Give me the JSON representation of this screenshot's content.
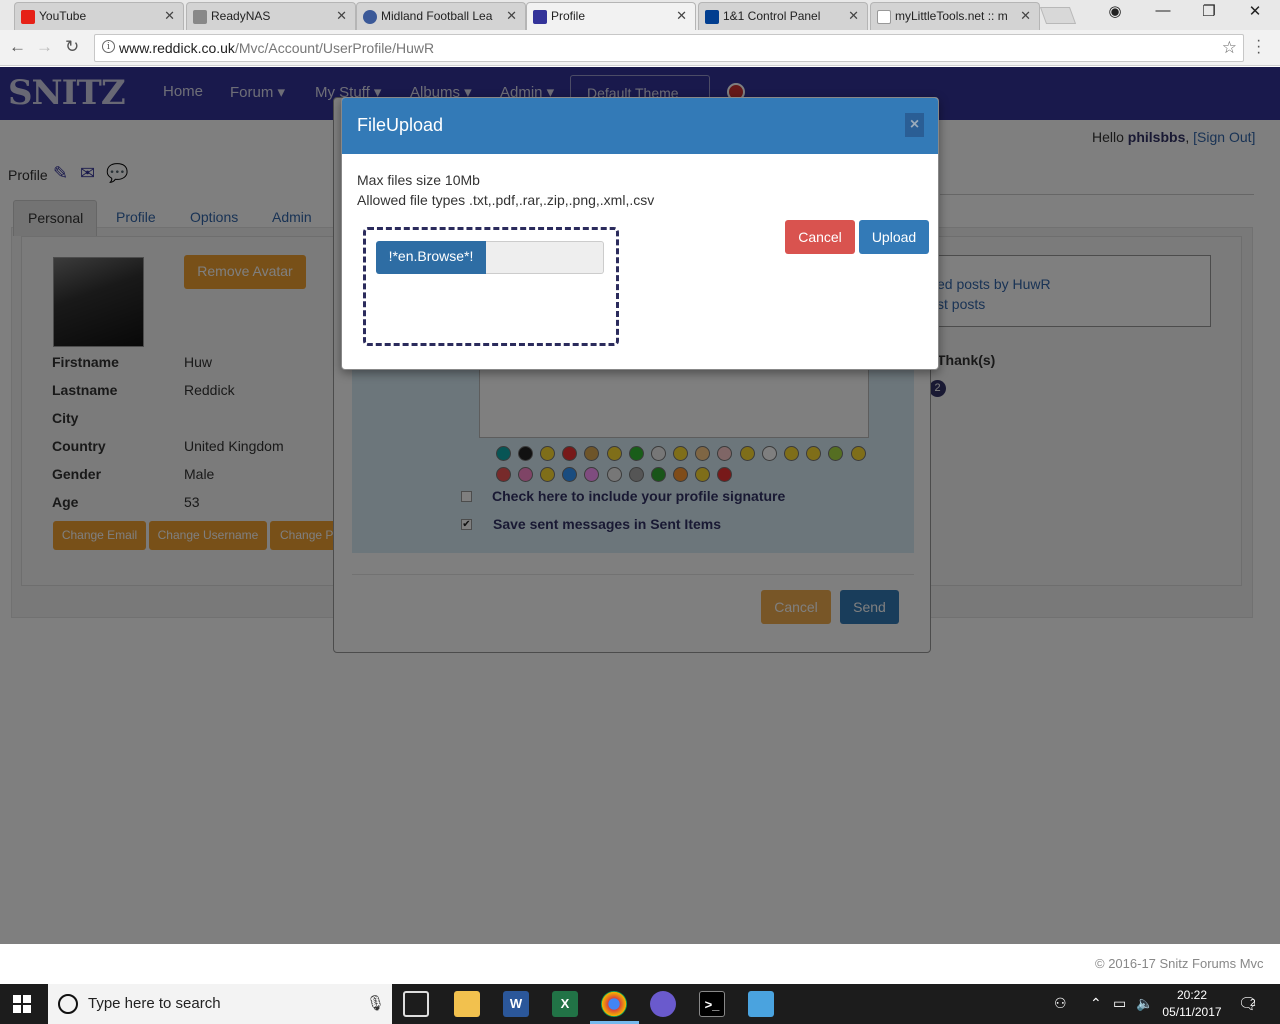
{
  "browser": {
    "tabs": [
      {
        "title": "YouTube",
        "favicon_color": "#e62117"
      },
      {
        "title": "ReadyNAS",
        "favicon_color": "#888888"
      },
      {
        "title": "Midland Football Lea",
        "favicon_color": "#3b5998"
      },
      {
        "title": "Profile",
        "favicon_color": "#333399"
      },
      {
        "title": "1&1 Control Panel",
        "favicon_color": "#003d8f"
      },
      {
        "title": "myLittleTools.net :: m",
        "favicon_color": "#999999"
      }
    ],
    "url_host": "www.reddick.co.uk",
    "url_path": "/Mvc/Account/UserProfile/HuwR"
  },
  "site": {
    "logo": "SNITZ",
    "nav": [
      "Home",
      "Forum ▾",
      "My Stuff ▾",
      "Albums ▾",
      "Admin ▾"
    ],
    "theme_select": "Default Theme",
    "hello_prefix": "Hello ",
    "hello_user": "philsbbs",
    "signout": "[Sign Out]",
    "footer": "© 2016-17 Snitz Forums Mvc"
  },
  "profile": {
    "heading": "Profile",
    "tabs": [
      "Personal",
      "Profile",
      "Options",
      "Admin"
    ],
    "remove_avatar": "Remove Avatar",
    "fields": [
      {
        "label": "Firstname",
        "value": "Huw"
      },
      {
        "label": "Lastname",
        "value": "Reddick"
      },
      {
        "label": "City",
        "value": ""
      },
      {
        "label": "Country",
        "value": "United Kingdom"
      },
      {
        "label": "Gender",
        "value": "Male"
      },
      {
        "label": "Age",
        "value": "53"
      }
    ],
    "buttons": [
      "Change Email",
      "Change Username",
      "Change P"
    ],
    "posts_line1": "ed posts by HuwR",
    "posts_line2": "st posts",
    "thanks": "Thank(s)",
    "thanks_count": "2"
  },
  "message_modal": {
    "include_signature": "Check here to include your profile signature",
    "save_sent": "Save sent messages in Sent Items",
    "cancel": "Cancel",
    "send": "Send"
  },
  "file_upload": {
    "title": "FileUpload",
    "close": "×",
    "max_size": "Max files size 10Mb",
    "allowed_types": "Allowed file types .txt,.pdf,.rar,.zip,.png,.xml,.csv",
    "browse": "!*en.Browse*!",
    "cancel": "Cancel",
    "upload": "Upload"
  },
  "taskbar": {
    "search_placeholder": "Type here to search",
    "time": "20:22",
    "date": "05/11/2017",
    "notification_count": "2"
  },
  "colors": {
    "primary": "#337ab7",
    "danger": "#d9534f",
    "warning": "#f0ad4e",
    "navbar": "#333399"
  }
}
